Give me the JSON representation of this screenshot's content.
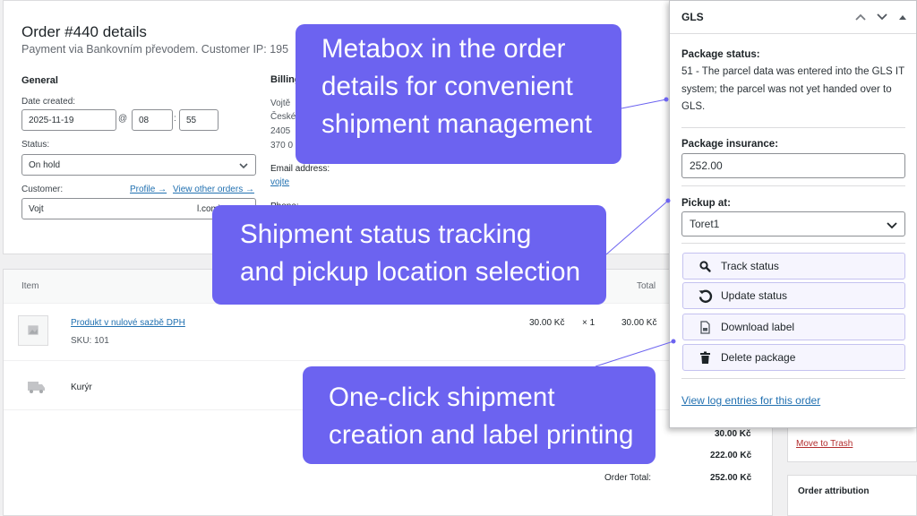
{
  "order": {
    "title": "Order #440 details",
    "subtitle": "Payment via Bankovním převodem. Customer IP: 195",
    "general_heading": "General",
    "billing_heading": "Billing",
    "date_label": "Date created:",
    "date_value": "2025-11-19",
    "at_sep": "@",
    "hour_value": "08",
    "colon_sep": ":",
    "minute_value": "55",
    "status_label": "Status:",
    "status_value": "On hold",
    "customer_label": "Customer:",
    "profile_link": "Profile →",
    "view_orders_link": "View other orders →",
    "customer_value_left": "Vojt",
    "customer_value_right": "l.com)",
    "billing_lines": [
      "Vojtě",
      "České",
      "2405",
      "370 0"
    ],
    "email_label": "Email address:",
    "email_value": "vojte",
    "phone_label": "Phone:"
  },
  "items": {
    "col_item": "Item",
    "col_total": "Total",
    "product_name": "Produkt v nulové sazbě DPH",
    "product_sku": "SKU: 101",
    "product_cost": "30.00 Kč",
    "product_qty": "× 1",
    "product_total": "30.00 Kč",
    "shipping_name": "Kurýr",
    "sum_1": "30.00 Kč",
    "sum_2": "222.00 Kč",
    "order_total_label": "Order Total:",
    "order_total_value": "252.00 Kč"
  },
  "side": {
    "move_to_trash": "Move to Trash",
    "order_attribution": "Order attribution"
  },
  "gls": {
    "title": "GLS",
    "package_status_label": "Package status:",
    "package_status_text": "51 - The parcel data was entered into the GLS IT system; the parcel was not yet handed over to GLS.",
    "insurance_label": "Package insurance:",
    "insurance_value": "252.00",
    "pickup_label": "Pickup at:",
    "pickup_value": "Toret1",
    "buttons": {
      "track": "Track status",
      "update": "Update status",
      "download": "Download label",
      "delete": "Delete package"
    },
    "log_link": "View log entries for this order"
  },
  "callouts": {
    "c1": [
      "Metabox in the order",
      "details for convenient",
      "shipment management"
    ],
    "c2": [
      "Shipment status tracking",
      "and pickup location selection"
    ],
    "c3": [
      "One-click shipment",
      "creation and label printing"
    ]
  },
  "colors": {
    "callout_bg": "#6c63f0",
    "link": "#2271b1",
    "button_bg": "#f6f5fe",
    "trash_link": "#b32d2e"
  }
}
